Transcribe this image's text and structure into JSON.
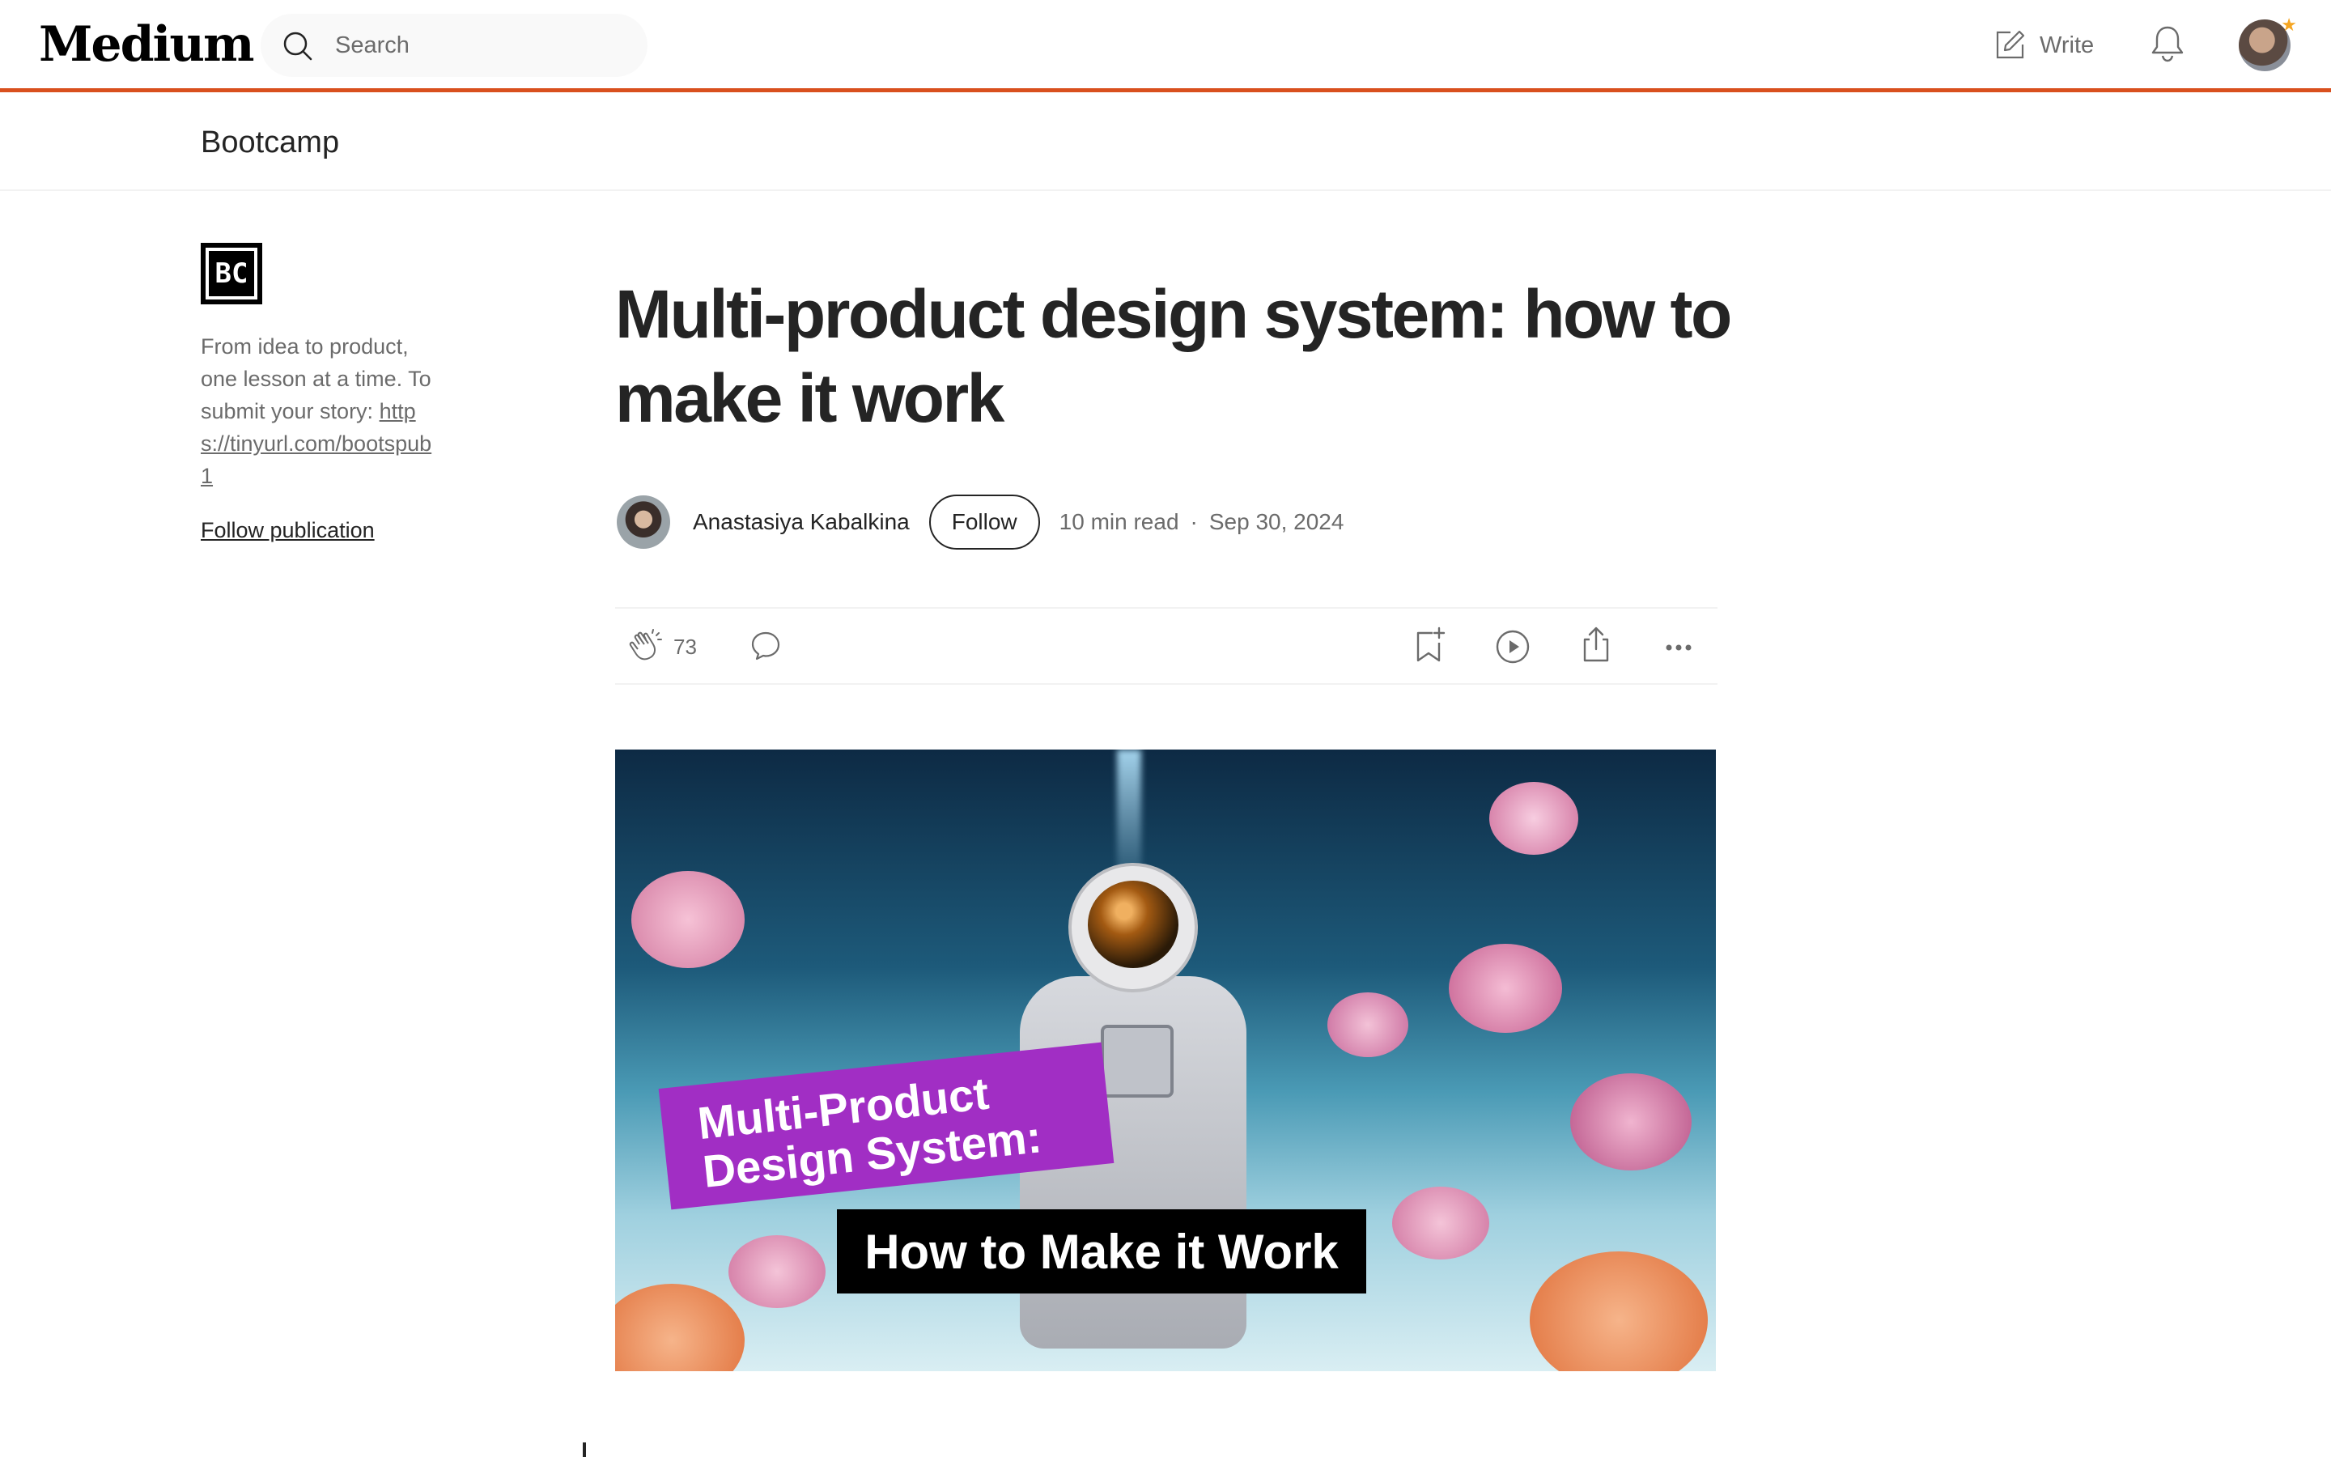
{
  "app": {
    "logo": "Medium"
  },
  "search": {
    "placeholder": "Search"
  },
  "header": {
    "write_label": "Write"
  },
  "publication": {
    "name": "Bootcamp",
    "logo_text": "BC",
    "description": "From idea to product, one lesson at a time. To submit your story:",
    "link": "https://tinyurl.com/bootspub1",
    "follow_label": "Follow publication"
  },
  "article": {
    "title": "Multi-product design system: how to make it work",
    "author": "Anastasiya Kabalkina",
    "follow_label": "Follow",
    "read_time": "10 min read",
    "separator": "·",
    "date": "Sep 30, 2024",
    "claps": "73"
  },
  "hero": {
    "tag_line1": "Multi-Product",
    "tag_line2": "Design System:",
    "tag_line3": "How to Make it Work"
  },
  "colors": {
    "accent": "#d9501e",
    "text": "#242424",
    "muted": "#6b6b6b",
    "hero_tag": "#a12ec4"
  },
  "icons": [
    "search-icon",
    "write-icon",
    "bell-icon",
    "clap-icon",
    "comment-icon",
    "bookmark-icon",
    "play-icon",
    "share-icon",
    "more-icon"
  ]
}
